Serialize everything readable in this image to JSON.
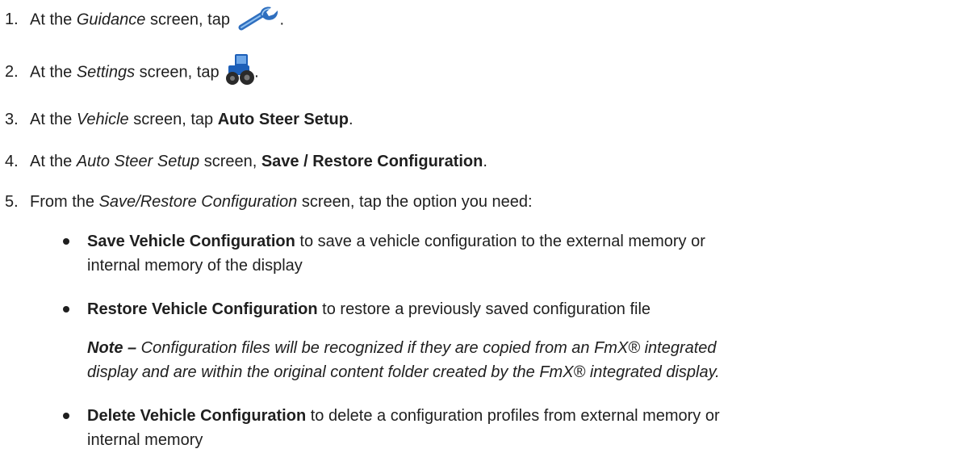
{
  "steps": [
    {
      "number": "1.",
      "pre": "At the ",
      "screen": "Guidance",
      "mid": " screen, tap ",
      "icon": "wrench-icon",
      "post": "."
    },
    {
      "number": "2.",
      "pre": "At the ",
      "screen": "Settings",
      "mid": " screen, tap ",
      "icon": "tractor-icon",
      "post": "."
    },
    {
      "number": "3.",
      "pre": "At the ",
      "screen": "Vehicle",
      "mid": " screen, tap ",
      "action": "Auto Steer Setup",
      "post": "."
    },
    {
      "number": "4.",
      "pre": "At the ",
      "screen": "Auto Steer Setup",
      "mid": " screen, ",
      "action": "Save / Restore Configuration",
      "post": "."
    },
    {
      "number": "5.",
      "pre": "From the ",
      "screen": "Save/Restore Configuration",
      "mid": " screen, tap the option you need:"
    }
  ],
  "options": [
    {
      "label": "Save Vehicle Configuration",
      "text_line1": " to save a vehicle configuration to the external memory or",
      "text_line2": "internal memory of the display"
    },
    {
      "label": "Restore Vehicle Configuration",
      "text_line1": " to restore a previously saved configuration file"
    },
    {
      "label": "Delete Vehicle Configuration",
      "text_line1": " to delete a configuration profiles from external memory or",
      "text_line2": "internal memory"
    }
  ],
  "note": {
    "label": "Note –",
    "line1": " Configuration files will be recognized if they are copied from an FmX® integrated",
    "line2": "display and are within the original content folder created by the FmX® integrated display."
  },
  "colors": {
    "text": "#1f1f1f",
    "wrench": "#2f6fbf",
    "tractor": "#1d5fb8"
  }
}
